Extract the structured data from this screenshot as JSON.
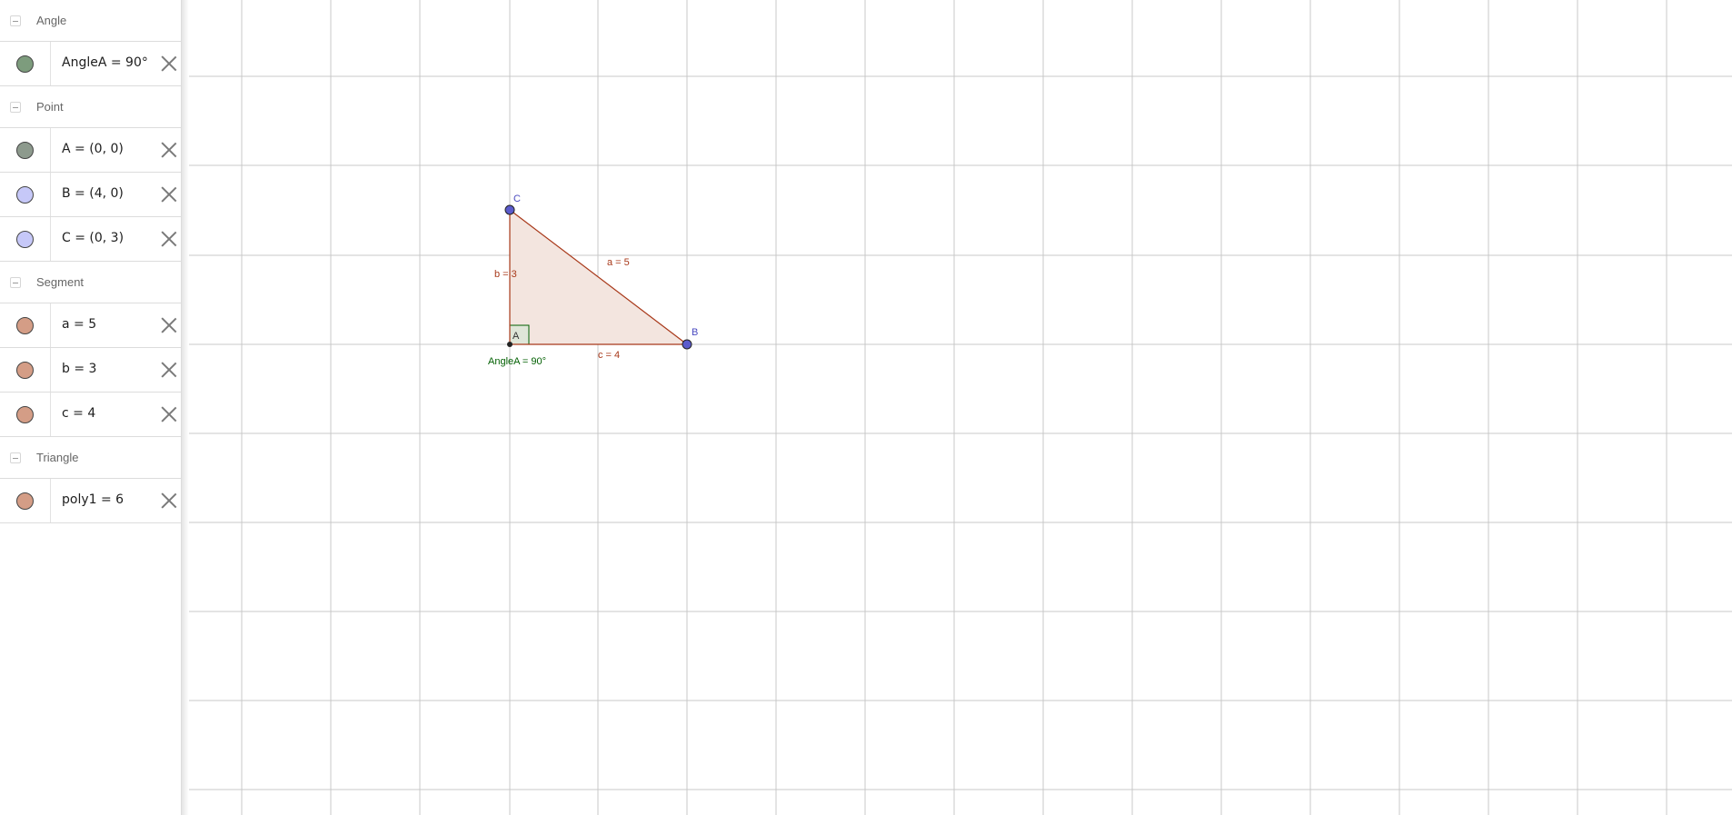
{
  "algebra": {
    "groups": [
      {
        "label": "Angle",
        "items": [
          {
            "expression": "AngleA = 90°",
            "marble_color": "#7d9c7d"
          }
        ]
      },
      {
        "label": "Point",
        "items": [
          {
            "expression": "A = (0, 0)",
            "marble_color": "#8d9a8d"
          },
          {
            "expression": "B = (4, 0)",
            "marble_color": "#c6c8f8"
          },
          {
            "expression": "C = (0, 3)",
            "marble_color": "#c6c8f8"
          }
        ]
      },
      {
        "label": "Segment",
        "items": [
          {
            "expression": "a = 5",
            "marble_color": "#d49d86"
          },
          {
            "expression": "b = 3",
            "marble_color": "#d49d86"
          },
          {
            "expression": "c = 4",
            "marble_color": "#d49d86"
          }
        ]
      },
      {
        "label": "Triangle",
        "items": [
          {
            "expression": "poly1 = 6",
            "marble_color": "#d49d86"
          }
        ]
      }
    ]
  },
  "graphics": {
    "grid_color": "#c8c8c8",
    "colors": {
      "segment": "#a8391a",
      "polygon_fill": "#f3e5df",
      "point_free": "#5b5bcc",
      "point_label": "#4a4ac0",
      "angle": "#005f00",
      "angle_fill": "#dfe6d8"
    },
    "labels": {
      "point_A": "A",
      "point_B": "B",
      "point_C": "C",
      "segment_a": "a = 5",
      "segment_b": "b = 3",
      "segment_c": "c = 4",
      "angle_A": "AngleA = 90°"
    }
  }
}
